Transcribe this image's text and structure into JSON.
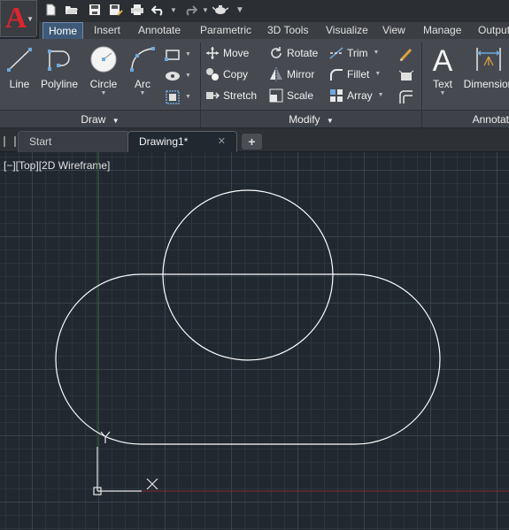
{
  "app": {
    "logo": "A"
  },
  "ribbon_tabs": [
    {
      "label": "Home",
      "active": true
    },
    {
      "label": "Insert"
    },
    {
      "label": "Annotate"
    },
    {
      "label": "Parametric"
    },
    {
      "label": "3D Tools"
    },
    {
      "label": "Visualize"
    },
    {
      "label": "View"
    },
    {
      "label": "Manage"
    },
    {
      "label": "Output"
    }
  ],
  "draw_panel": {
    "title": "Draw",
    "tools": [
      {
        "label": "Line",
        "icon": "line-icon"
      },
      {
        "label": "Polyline",
        "icon": "polyline-icon"
      },
      {
        "label": "Circle",
        "icon": "circle-icon"
      },
      {
        "label": "Arc",
        "icon": "arc-icon"
      }
    ]
  },
  "modify_panel": {
    "title": "Modify",
    "tools": [
      {
        "label": "Move",
        "icon": "move-icon"
      },
      {
        "label": "Rotate",
        "icon": "rotate-icon"
      },
      {
        "label": "Trim",
        "icon": "trim-icon"
      },
      {
        "label": "Copy",
        "icon": "copy-icon"
      },
      {
        "label": "Mirror",
        "icon": "mirror-icon"
      },
      {
        "label": "Fillet",
        "icon": "fillet-icon"
      },
      {
        "label": "Stretch",
        "icon": "stretch-icon"
      },
      {
        "label": "Scale",
        "icon": "scale-icon"
      },
      {
        "label": "Array",
        "icon": "array-icon"
      }
    ]
  },
  "annotation_panel": {
    "title": "Annotat",
    "tools": [
      {
        "label": "Text",
        "icon": "text-icon"
      },
      {
        "label": "Dimension",
        "icon": "dimension-icon"
      }
    ]
  },
  "file_tabs": [
    {
      "label": "Start",
      "active": false
    },
    {
      "label": "Drawing1*",
      "active": true
    }
  ],
  "viewport": {
    "controls": "[−][Top][2D Wireframe]",
    "ucs_x": "X",
    "ucs_y": "Y"
  },
  "colors": {
    "accent": "#3f5a78",
    "canvas": "#212830",
    "app_logo": "#d9262c",
    "x_axis": "#7a2a2a",
    "y_axis": "#2b5a2b"
  }
}
